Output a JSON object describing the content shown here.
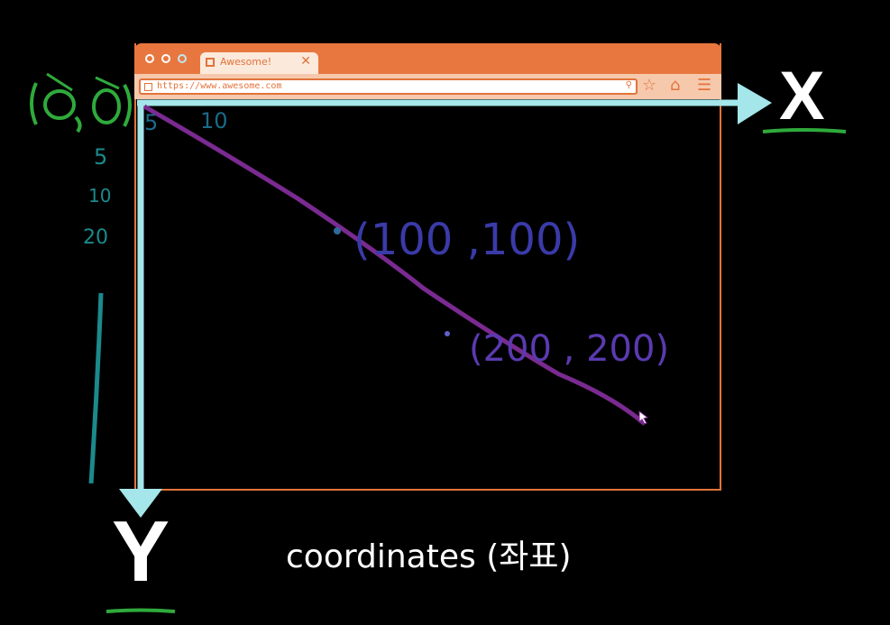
{
  "browser": {
    "tab_title": "Awesome!",
    "tab_close": "✕",
    "url": "https://www.awesome.com",
    "toolbar_icons": [
      "star-icon",
      "home-icon",
      "menu-icon"
    ]
  },
  "annotations": {
    "origin_label": "(0,0)",
    "x_ticks": [
      "5",
      "10"
    ],
    "y_ticks": [
      "5",
      "10",
      "20"
    ],
    "point1_label": "(100 ,100)",
    "point2_label": "(200 , 200)",
    "x_axis_label": "X",
    "y_axis_label": "Y"
  },
  "caption": "coordinates (좌표)",
  "colors": {
    "browser_accent": "#e8773f",
    "axis_arrow": "#a4e6ea",
    "origin_green": "#2faa3c",
    "tick_teal": "#1b8a8c",
    "point_blue": "#3a3aa8",
    "line_purple": "#7a2a90",
    "underline_green": "#2faa3c"
  }
}
